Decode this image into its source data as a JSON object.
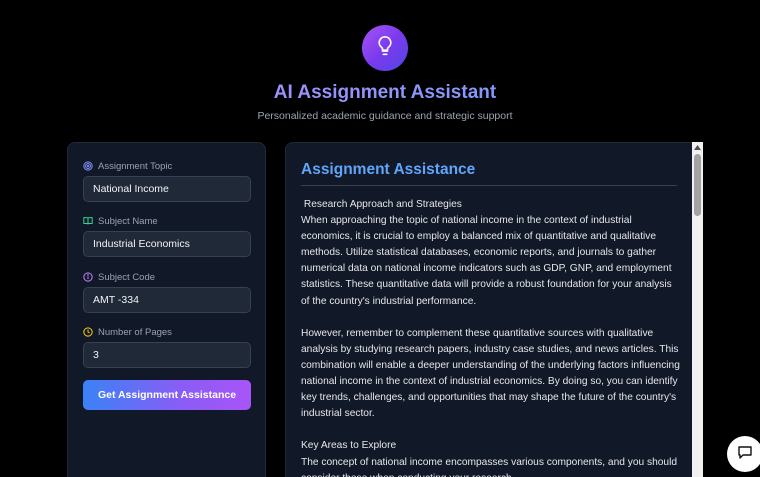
{
  "header": {
    "logo_icon": "lightbulb-icon",
    "title": "AI Assignment Assistant",
    "subtitle": "Personalized academic guidance and strategic support"
  },
  "form": {
    "fields": [
      {
        "icon": "target-icon",
        "label": "Assignment Topic",
        "value": "National Income",
        "icon_color": "#818cf8"
      },
      {
        "icon": "book-icon",
        "label": "Subject Name",
        "value": "Industrial Economics",
        "icon_color": "#34d399"
      },
      {
        "icon": "info-icon",
        "label": "Subject Code",
        "value": "AMT -334",
        "icon_color": "#c084fc"
      },
      {
        "icon": "clock-icon",
        "label": "Number of Pages",
        "value": "3",
        "icon_color": "#facc15"
      }
    ],
    "submit_label": "Get Assignment Assistance"
  },
  "result": {
    "title": "Assignment Assistance",
    "paragraphs": [
      " Research Approach and Strategies",
      "When approaching the topic of national income in the context of industrial economics, it is crucial to employ a balanced mix of quantitative and qualitative methods. Utilize statistical databases, economic reports, and journals to gather numerical data on national income indicators such as GDP, GNP, and employment statistics. These quantitative data will provide a robust foundation for your analysis of the country's industrial performance.",
      "",
      "However, remember to complement these quantitative sources with qualitative analysis by studying research papers, industry case studies, and news articles. This combination will enable a deeper understanding of the underlying factors influencing national income in the context of industrial economics. By doing so, you can identify key trends, challenges, and opportunities that may shape the future of the country's industrial sector.",
      "",
      "Key Areas to Explore",
      "The concept of national income encompasses various components, and you should consider these when conducting your research."
    ]
  },
  "chat_icon": "chat-bubble-icon",
  "colors": {
    "background": "#000000",
    "panel": "#111827",
    "input": "#1f2937",
    "accent_blue": "#60a5fa",
    "accent_purple": "#a855f7"
  }
}
